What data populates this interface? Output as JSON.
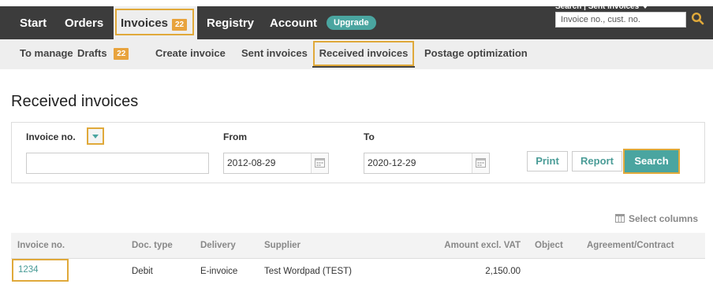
{
  "topnav": {
    "items": [
      {
        "label": "Start"
      },
      {
        "label": "Orders"
      },
      {
        "label": "Invoices",
        "badge": "22"
      },
      {
        "label": "Registry"
      },
      {
        "label": "Account"
      }
    ],
    "upgrade_label": "Upgrade",
    "search_caption": "Search | Sent invoices",
    "search_placeholder": "Invoice no., cust. no."
  },
  "subnav": {
    "items": [
      {
        "label": "To manage"
      },
      {
        "label": "Drafts",
        "badge": "22"
      },
      {
        "label": "Create invoice"
      },
      {
        "label": "Sent invoices"
      },
      {
        "label": "Received invoices"
      },
      {
        "label": "Postage optimization"
      }
    ]
  },
  "page_title": "Received invoices",
  "filter": {
    "field_label": "Invoice no.",
    "field_value": "",
    "from_label": "From",
    "from_value": "2012-08-29",
    "to_label": "To",
    "to_value": "2020-12-29",
    "print_label": "Print",
    "report_label": "Report",
    "search_label": "Search"
  },
  "select_columns_label": "Select columns",
  "table": {
    "headers": [
      "Invoice no.",
      "Doc. type",
      "Delivery",
      "Supplier",
      "Amount excl. VAT",
      "Object",
      "Agreement/Contract"
    ],
    "rows": [
      {
        "invoice_no": "1234",
        "doc_type": "Debit",
        "delivery": "E-invoice",
        "supplier": "Test Wordpad (TEST)",
        "amount": "2,150.00",
        "object": "",
        "agreement": ""
      }
    ]
  },
  "colors": {
    "accent": "#4aa5a0",
    "highlight": "#e0a93a",
    "nav_bg": "#3c3c3c",
    "badge": "#e8a33d"
  }
}
